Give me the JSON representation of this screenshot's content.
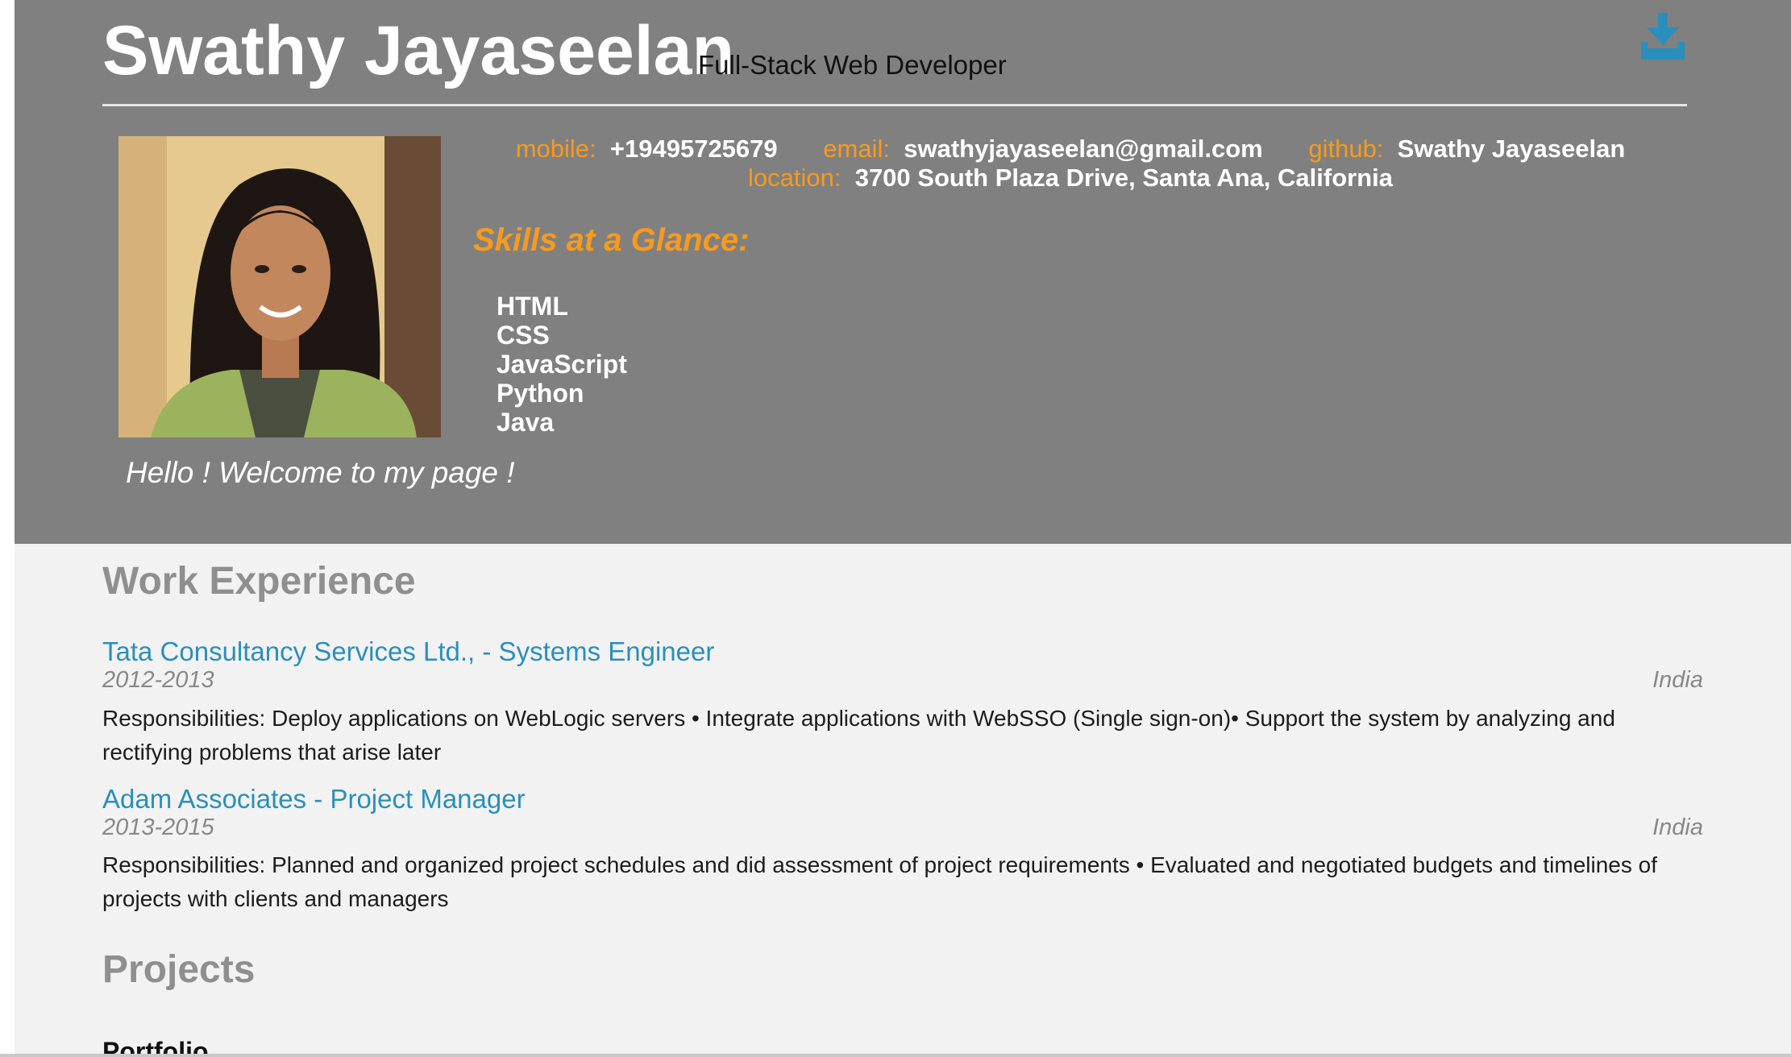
{
  "header": {
    "name": "Swathy Jayaseelan",
    "title": "Full-Stack Web Developer",
    "download_icon": "download-icon"
  },
  "contact": {
    "mobile_label": "mobile:",
    "mobile": "+19495725679",
    "email_label": "email:",
    "email": "swathyjayaseelan@gmail.com",
    "github_label": "github:",
    "github": "Swathy Jayaseelan",
    "location_label": "location:",
    "location": "3700 South Plaza Drive, Santa Ana, California"
  },
  "skills": {
    "heading": "Skills at a Glance:",
    "items": [
      "HTML",
      "CSS",
      "JavaScript",
      "Python",
      "Java"
    ]
  },
  "welcome": "Hello ! Welcome to my page !",
  "work": {
    "heading": "Work Experience",
    "jobs": [
      {
        "title": "Tata Consultancy Services Ltd., - Systems Engineer",
        "years": "2012-2013",
        "location": "India",
        "description": "Responsibilities: Deploy applications on WebLogic servers • Integrate applications with WebSSO (Single sign-on)• Support the system by analyzing and rectifying problems that arise later"
      },
      {
        "title": "Adam Associates - Project Manager",
        "years": "2013-2015",
        "location": "India",
        "description": "Responsibilities: Planned and organized project schedules and did assessment of project requirements • Evaluated and negotiated budgets and timelines of projects with clients and managers"
      }
    ]
  },
  "projects": {
    "heading": "Projects",
    "items": [
      {
        "name": "Portfolio"
      }
    ]
  },
  "colors": {
    "banner": "#808080",
    "accent_orange": "#f79a1d",
    "link_blue": "#2a8fbd",
    "page_bg": "#f2f2f2"
  }
}
